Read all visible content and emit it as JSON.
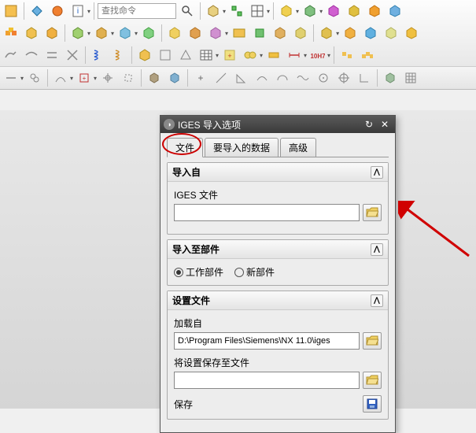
{
  "toolbar": {
    "search_placeholder": "查找命令"
  },
  "dialog": {
    "title": "IGES 导入选项",
    "tabs": {
      "file": "文件",
      "data": "要导入的数据",
      "advanced": "高级"
    },
    "sections": {
      "import_from": {
        "title": "导入自",
        "iges_file_label": "IGES 文件",
        "iges_file_value": ""
      },
      "import_to": {
        "title": "导入至部件",
        "work_part": "工作部件",
        "new_part": "新部件",
        "selected": "work_part"
      },
      "settings": {
        "title": "设置文件",
        "load_from_label": "加载自",
        "load_from_value": "D:\\Program Files\\Siemens\\NX 11.0\\iges",
        "save_to_label": "将设置保存至文件",
        "save_to_value": "",
        "save_label": "保存"
      }
    }
  }
}
